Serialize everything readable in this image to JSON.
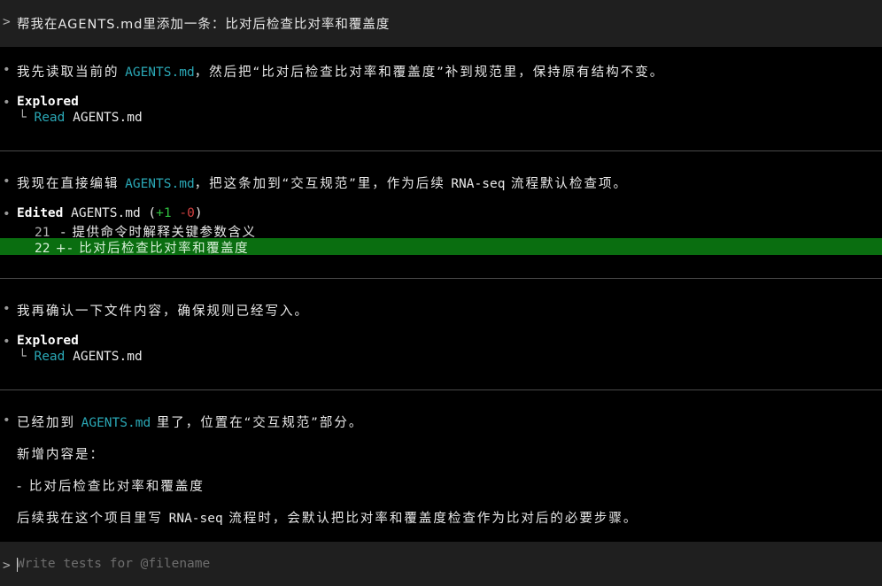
{
  "prompt": {
    "marker": ">",
    "text": "帮我在AGENTS.md里添加一条：比对后检查比对率和覆盖度"
  },
  "messages": {
    "m1": {
      "pre": "我先读取当前的 ",
      "file": "AGENTS.md",
      "post": "，然后把“比对后检查比对率和覆盖度”补到规范里，保持原有结构不变。"
    },
    "explore1": {
      "title": "Explored",
      "tree": "└",
      "action": "Read",
      "file": "AGENTS.md"
    },
    "m2": {
      "pre": "我现在直接编辑 ",
      "file": "AGENTS.md",
      "mid": "，把这条加到“交互规范”里，作为后续 ",
      "code": "RNA-seq",
      "post": " 流程默认检查项。"
    },
    "edit": {
      "title": "Edited",
      "file": "AGENTS.md",
      "open": " (",
      "plus": "+1",
      "minus": "-0",
      "close": ")",
      "line1_no": "21",
      "line1_text": "  - 提供命令时解释关键参数含义",
      "line2_no": "22",
      "line2_text": " +- 比对后检查比对率和覆盖度"
    },
    "m3": {
      "text": "我再确认一下文件内容，确保规则已经写入。"
    },
    "explore2": {
      "title": "Explored",
      "tree": "└",
      "action": "Read",
      "file": "AGENTS.md"
    },
    "m4": {
      "pre": "已经加到 ",
      "file": "AGENTS.md",
      "post": " 里了，位置在“交互规范”部分。",
      "p2": "新增内容是：",
      "p3": "- 比对后检查比对率和覆盖度",
      "p4_pre": "后续我在这个项目里写 ",
      "p4_code": "RNA-seq",
      "p4_post": " 流程时，会默认把比对率和覆盖度检查作为比对后的必要步骤。"
    }
  },
  "bullet": "•",
  "input": {
    "marker": ">",
    "placeholder": "Write tests for @filename"
  }
}
